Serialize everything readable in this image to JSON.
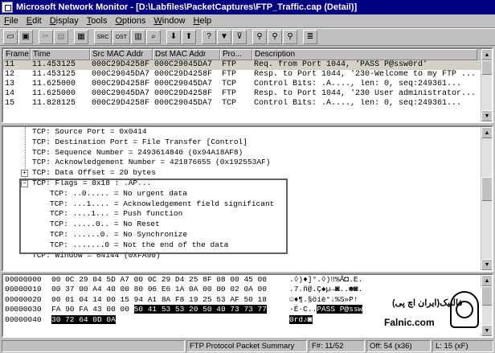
{
  "window": {
    "title": "Microsoft Network Monitor - [D:\\Labfiles\\PacketCaptures\\FTP_Traffic.cap (Detail)]"
  },
  "menu": [
    "File",
    "Edit",
    "Display",
    "Tools",
    "Options",
    "Window",
    "Help"
  ],
  "toolbar": {
    "buttons": [
      {
        "name": "open-icon",
        "glyph": "▭"
      },
      {
        "name": "save-icon",
        "glyph": "▣"
      },
      {
        "sep": true
      },
      {
        "name": "cut-icon",
        "glyph": "✂",
        "dim": true
      },
      {
        "name": "copy-icon",
        "glyph": "▤",
        "dim": true
      },
      {
        "sep": true
      },
      {
        "name": "print-icon",
        "glyph": "▦"
      },
      {
        "sep": true
      },
      {
        "name": "source-mac-icon",
        "glyph": "SRC",
        "wide": true
      },
      {
        "name": "dest-mac-icon",
        "glyph": "DST",
        "wide": true
      },
      {
        "name": "filter-grid-icon",
        "glyph": "▥"
      },
      {
        "name": "zoom-icon",
        "glyph": "⌕"
      },
      {
        "sep": true
      },
      {
        "name": "arrow-down-icon",
        "glyph": "⬇"
      },
      {
        "name": "arrow-up-icon",
        "glyph": "⬆"
      },
      {
        "sep": true
      },
      {
        "name": "help-icon",
        "glyph": "?"
      },
      {
        "name": "filter-icon",
        "glyph": "▼"
      },
      {
        "name": "filter-edit-icon",
        "glyph": "⊽"
      },
      {
        "sep": true
      },
      {
        "name": "find-icon",
        "glyph": "⚲"
      },
      {
        "name": "find-next-icon",
        "glyph": "⚲"
      },
      {
        "name": "find-prev-icon",
        "glyph": "⚲"
      },
      {
        "sep": true
      },
      {
        "name": "properties-icon",
        "glyph": "≣"
      }
    ]
  },
  "summary": {
    "columns": [
      "Frame",
      "Time",
      "Src MAC Addr",
      "Dst MAC Addr",
      "Pro...",
      "Description"
    ],
    "rows": [
      {
        "frame": "11",
        "time": "11.453125",
        "src": "000C29D4258F",
        "dst": "000C29045DA7",
        "proto": "FTP",
        "desc": "Req. from Port 1044, 'PASS P@ssw0rd'",
        "selected": true
      },
      {
        "frame": "12",
        "time": "11.453125",
        "src": "000C29045DA7",
        "dst": "000C29D4258F",
        "proto": "FTP",
        "desc": "Resp. to Port 1044, '230-Welcome to my FTP ..."
      },
      {
        "frame": "13",
        "time": "11.625000",
        "src": "000C29D4258F",
        "dst": "000C29045DA7",
        "proto": "TCP",
        "desc": "Control Bits: .A...., len:    0, seq:249361..."
      },
      {
        "frame": "14",
        "time": "11.625000",
        "src": "000C29045DA7",
        "dst": "000C29D4258F",
        "proto": "FTP",
        "desc": "Resp. to Port 1044, '230 User administrator..."
      },
      {
        "frame": "15",
        "time": "11.828125",
        "src": "000C29D4258F",
        "dst": "000C29045DA7",
        "proto": "TCP",
        "desc": "Control Bits: .A...., len:    0, seq:249361..."
      }
    ]
  },
  "detail": {
    "lines": [
      {
        "indent": 0,
        "text": "TCP: Source Port = 0x0414"
      },
      {
        "indent": 0,
        "text": "TCP: Destination Port = File Transfer [Control]"
      },
      {
        "indent": 0,
        "text": "TCP: Sequence Number = 2493614840 (0x94A18AF8)"
      },
      {
        "indent": 0,
        "text": "TCP: Acknowledgement Number = 421876655 (0x192553AF)"
      },
      {
        "indent": 0,
        "text": "TCP: Data Offset = 20 bytes",
        "expander": "+"
      },
      {
        "indent": 0,
        "text": "TCP: Flags = 0x18 : .AP...",
        "expander": "−"
      },
      {
        "indent": 1,
        "text": "TCP: ..0..... = No urgent data"
      },
      {
        "indent": 1,
        "text": "TCP: ...1.... = Acknowledgement field significant"
      },
      {
        "indent": 1,
        "text": "TCP: ....1... = Push function"
      },
      {
        "indent": 1,
        "text": "TCP: .....0.. = No Reset"
      },
      {
        "indent": 1,
        "text": "TCP: ......0. = No Synchronize"
      },
      {
        "indent": 1,
        "text": "TCP: .......0 = Not the end of the data"
      },
      {
        "indent": 0,
        "text": "TCP: Window = 64144 (0xFA90)"
      }
    ]
  },
  "hex": {
    "rows": [
      {
        "offset": "00000000",
        "bytes": "00 0C 29 04 5D A7 00 0C 29 D4 25 8F 08 00 45 00",
        "ascii": ".◊)♦]°.◊)‼%Å◘.E."
      },
      {
        "offset": "00000010",
        "bytes": "00 37 00 A4 40 00 80 06 E6 1A 0A 00 00 02 0A 00",
        "ascii": ".7.ñ@.Ç♠µ→◙..☻◙."
      },
      {
        "offset": "00000020",
        "bytes": "00 01 04 14 00 15 94 A1 8A F8 19 25 53 AF 50 18",
        "ascii": "☺♦¶.§öíè°↓%S»P↑"
      },
      {
        "offset": "00000030",
        "bytes_plain": "FA 90 FA 43 00 00 ",
        "bytes_hl": "50 41 53 53 20 50 40 73 73 77",
        "ascii_plain": "·É·C..",
        "ascii_hl": "PASS P@ssw"
      },
      {
        "offset": "00000040",
        "bytes_plain": "",
        "bytes_hl": "30 72 64 0D 0A",
        "ascii_plain": "",
        "ascii_hl": "0rd♪◙"
      }
    ]
  },
  "logo": {
    "fa": "فالنیک(ایران اچ پی)",
    "en": "Falnic.com"
  },
  "status": {
    "panels": [
      "",
      "FTP Protocol Packet Summary",
      "F#: 11/52",
      "Off: 54 (x36)",
      "L: 15 (xF)"
    ]
  }
}
